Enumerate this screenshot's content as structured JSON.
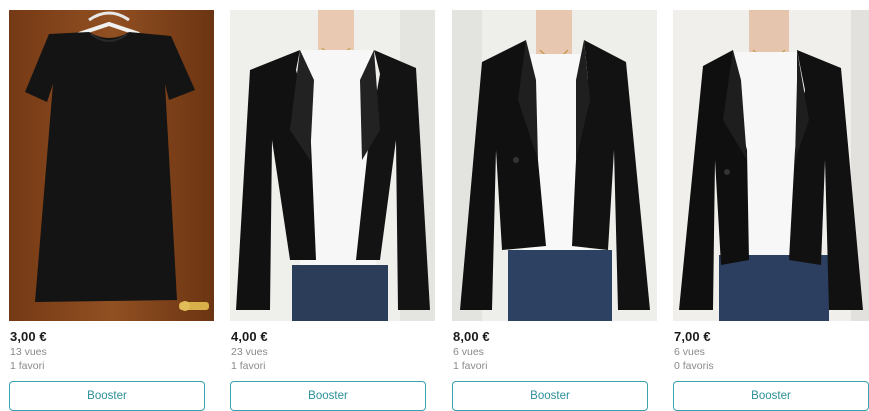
{
  "items": [
    {
      "price": "3,00 €",
      "views": "13 vues",
      "favorites": "1 favori",
      "button": "Booster",
      "image": "black-dress-photo"
    },
    {
      "price": "4,00 €",
      "views": "23 vues",
      "favorites": "1 favori",
      "button": "Booster",
      "image": "black-open-blazer-photo"
    },
    {
      "price": "8,00 €",
      "views": "6 vues",
      "favorites": "1 favori",
      "button": "Booster",
      "image": "black-buttoned-blazer-photo"
    },
    {
      "price": "7,00 €",
      "views": "6 vues",
      "favorites": "0 favoris",
      "button": "Booster",
      "image": "black-fitted-blazer-photo"
    }
  ],
  "colors": {
    "accent": "#3aa2ad",
    "price_text": "#1a1a1a",
    "meta_text": "#8a8a8a",
    "door_wood": "#8b4a1f",
    "wall": "#f2f2f0"
  }
}
